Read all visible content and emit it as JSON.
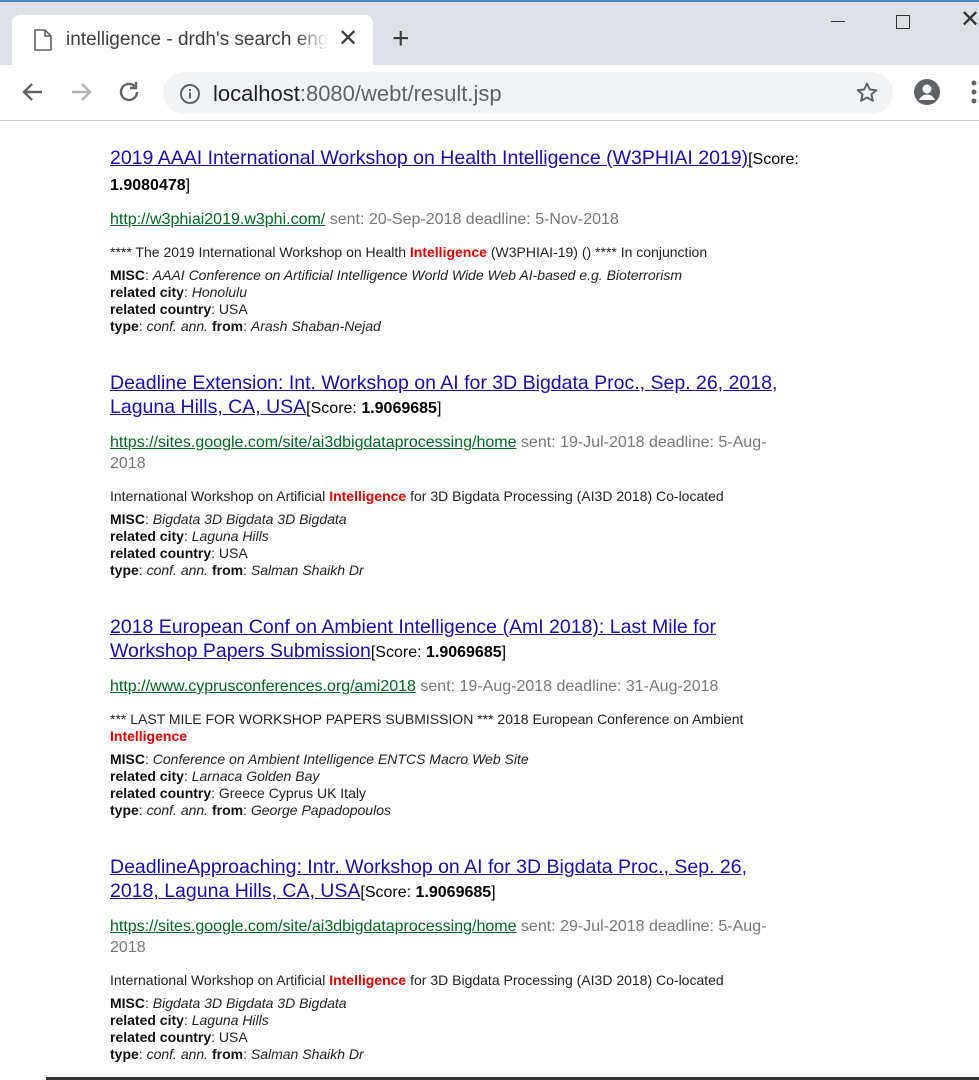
{
  "browser": {
    "tab_title": "intelligence - drdh's search engine",
    "tab_close": "✕",
    "new_tab": "+",
    "url_host": "localhost",
    "url_rest": ":8080/webt/result.jsp"
  },
  "search": {
    "highlight_term": "Intelligence"
  },
  "results": [
    {
      "title": "2019 AAAI International Workshop on Health Intelligence (W3PHIAI 2019)",
      "score_label": "Score: ",
      "score": "1.9080478",
      "url": "http://w3phiai2019.w3phi.com/",
      "sent": "sent: 20-Sep-2018 deadline: 5-Nov-2018",
      "snippet_before": "**** The 2019 International Workshop on Health ",
      "snippet_after": " (W3PHIAI-19) () **** In conjunction",
      "misc_label": "MISC",
      "misc": "AAAI Conference on Artificial Intelligence World Wide Web AI-based e.g. Bioterrorism",
      "city_label": "related city",
      "city": "Honolulu",
      "country_label": "related country",
      "country": "USA",
      "type_label": "type",
      "type": "conf. ann.",
      "from_label": "from",
      "from": "Arash Shaban-Nejad"
    },
    {
      "title": "Deadline Extension: Int. Workshop on AI for 3D Bigdata Proc., Sep. 26, 2018, Laguna Hills, CA, USA",
      "score_label": "Score: ",
      "score": "1.9069685",
      "url": "https://sites.google.com/site/ai3dbigdataprocessing/home",
      "sent": "sent: 19-Jul-2018 deadline: 5-Aug-2018",
      "snippet_before": "International Workshop on Artificial ",
      "snippet_after": " for 3D Bigdata Processing (AI3D 2018) Co-located",
      "misc_label": "MISC",
      "misc": "Bigdata 3D Bigdata 3D Bigdata",
      "city_label": "related city",
      "city": "Laguna Hills",
      "country_label": "related country",
      "country": "USA",
      "type_label": "type",
      "type": "conf. ann.",
      "from_label": "from",
      "from": "Salman Shaikh Dr"
    },
    {
      "title": "2018 European Conf on Ambient Intelligence (AmI 2018): Last Mile for Workshop Papers Submission",
      "score_label": "Score: ",
      "score": "1.9069685",
      "url": "http://www.cyprusconferences.org/ami2018",
      "sent": "sent: 19-Aug-2018 deadline: 31-Aug-2018",
      "snippet_before": "*** LAST MILE FOR WORKSHOP PAPERS SUBMISSION *** 2018 European Conference on Ambient ",
      "snippet_after": "",
      "misc_label": "MISC",
      "misc": "Conference on Ambient Intelligence ENTCS Macro Web Site",
      "city_label": "related city",
      "city": "Larnaca Golden Bay",
      "country_label": "related country",
      "country": "Greece Cyprus UK Italy",
      "type_label": "type",
      "type": "conf. ann.",
      "from_label": "from",
      "from": "George Papadopoulos"
    },
    {
      "title": "DeadlineApproaching: Intr. Workshop on AI for 3D Bigdata Proc., Sep. 26, 2018, Laguna Hills, CA, USA",
      "score_label": "Score: ",
      "score": "1.9069685",
      "url": "https://sites.google.com/site/ai3dbigdataprocessing/home",
      "sent": "sent: 29-Jul-2018 deadline: 5-Aug-2018",
      "snippet_before": "International Workshop on Artificial ",
      "snippet_after": " for 3D Bigdata Processing (AI3D 2018) Co-located",
      "misc_label": "MISC",
      "misc": "Bigdata 3D Bigdata 3D Bigdata",
      "city_label": "related city",
      "city": "Laguna Hills",
      "country_label": "related country",
      "country": "USA",
      "type_label": "type",
      "type": "conf. ann.",
      "from_label": "from",
      "from": "Salman Shaikh Dr"
    }
  ]
}
